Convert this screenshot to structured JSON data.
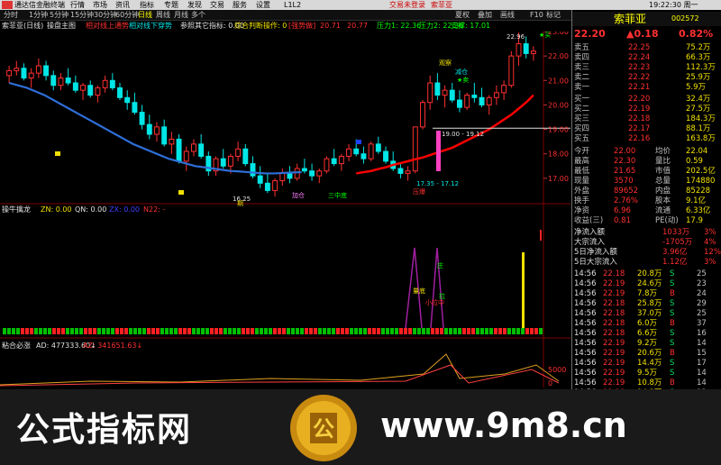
{
  "menu": {
    "app": "通达信金融终端",
    "items": [
      "行情",
      "市场",
      "资讯",
      "指标",
      "专题",
      "发现",
      "交易",
      "服务",
      "设置",
      "L1L2"
    ],
    "login": "交易未登录",
    "stock": "索菲亚",
    "quick": [
      "夏权",
      "叠加",
      "画线",
      "F10",
      "标记",
      "-",
      "□",
      "×"
    ]
  },
  "periods": [
    "分时",
    "1分钟",
    "5分钟",
    "15分钟",
    "30分钟",
    "60分钟",
    "日线",
    "周线",
    "月线",
    "多个"
  ],
  "title": {
    "name": "索菲亚(日线)",
    "indicator": "操盘主图",
    "t1": "相对线上通势",
    "t2": "相对线下穿势",
    "t3": "参照其它指标: 0.00",
    "t4": "综合判断操作: 0",
    "t5": "[强势做]",
    "t6": "20.71",
    "t7": "20.77",
    "t8": "压力1: 22.36",
    "t9": "压力2: 22.36",
    "t10": "支撑: 17.01"
  },
  "chart_data": [
    {
      "type": "candlestick",
      "title": "操盘主图",
      "ylim": [
        16,
        23
      ],
      "y_ticks": [
        23,
        22,
        21,
        20,
        19,
        18,
        17
      ],
      "annotations": [
        {
          "text": "22.96"
        },
        {
          "text": "★买"
        },
        {
          "text": "观察"
        },
        {
          "text": "减仓"
        },
        {
          "text": "★卖"
        },
        {
          "text": "19.00 - 19.12"
        },
        {
          "text": "16.25"
        },
        {
          "text": "17.35 - 17.12"
        },
        {
          "text": "加仓"
        },
        {
          "text": "三中底"
        },
        {
          "text": "压爆"
        },
        {
          "text": "期"
        }
      ],
      "series": [
        {
          "name": "K线",
          "ohlc": [
            [
              21.2,
              21.6,
              20.9,
              21.4
            ],
            [
              21.4,
              21.8,
              21.2,
              21.5
            ],
            [
              21.5,
              21.7,
              21.0,
              21.1
            ],
            [
              21.1,
              21.5,
              20.7,
              21.3
            ],
            [
              21.3,
              21.9,
              21.1,
              21.6
            ],
            [
              21.6,
              21.8,
              21.0,
              21.2
            ],
            [
              21.2,
              21.4,
              20.6,
              20.8
            ],
            [
              20.8,
              21.3,
              20.6,
              21.1
            ],
            [
              21.1,
              21.5,
              20.8,
              20.9
            ],
            [
              20.9,
              21.2,
              20.5,
              20.6
            ],
            [
              20.6,
              20.9,
              20.2,
              20.8
            ],
            [
              20.8,
              21.0,
              20.3,
              20.4
            ],
            [
              20.4,
              20.8,
              20.1,
              20.7
            ],
            [
              20.7,
              21.2,
              20.5,
              21.0
            ],
            [
              21.0,
              21.3,
              20.6,
              20.7
            ],
            [
              20.7,
              20.9,
              20.2,
              20.3
            ],
            [
              20.3,
              20.6,
              19.8,
              20.1
            ],
            [
              20.1,
              20.5,
              19.6,
              19.7
            ],
            [
              19.7,
              20.0,
              19.0,
              19.2
            ],
            [
              19.2,
              19.6,
              18.6,
              18.8
            ],
            [
              18.8,
              19.3,
              18.5,
              19.1
            ],
            [
              19.1,
              19.4,
              18.3,
              18.4
            ],
            [
              18.4,
              18.9,
              18.0,
              18.6
            ],
            [
              18.6,
              18.8,
              17.6,
              17.7
            ],
            [
              17.7,
              18.3,
              17.3,
              18.1
            ],
            [
              18.1,
              18.6,
              17.9,
              18.4
            ],
            [
              18.4,
              18.8,
              17.8,
              17.9
            ],
            [
              17.9,
              18.1,
              17.1,
              17.3
            ],
            [
              17.3,
              17.9,
              17.1,
              17.8
            ],
            [
              17.8,
              18.2,
              17.4,
              17.5
            ],
            [
              17.5,
              18.0,
              17.2,
              17.9
            ],
            [
              17.9,
              18.5,
              17.7,
              18.2
            ],
            [
              18.2,
              18.4,
              17.5,
              17.6
            ],
            [
              17.6,
              17.9,
              17.0,
              17.1
            ],
            [
              17.1,
              17.5,
              16.6,
              16.8
            ],
            [
              16.8,
              17.2,
              16.4,
              16.5
            ],
            [
              16.5,
              17.0,
              16.25,
              16.9
            ],
            [
              16.9,
              17.4,
              16.7,
              17.2
            ],
            [
              17.2,
              17.5,
              16.8,
              17.0
            ],
            [
              17.0,
              17.6,
              16.9,
              17.4
            ],
            [
              17.4,
              17.8,
              17.2,
              17.3
            ],
            [
              17.3,
              17.6,
              16.9,
              17.1
            ],
            [
              17.1,
              17.4,
              16.8,
              17.3
            ],
            [
              17.3,
              17.9,
              17.2,
              17.8
            ],
            [
              17.8,
              18.2,
              17.5,
              17.6
            ],
            [
              17.6,
              18.0,
              17.3,
              17.9
            ],
            [
              17.9,
              18.4,
              17.7,
              18.2
            ],
            [
              18.2,
              18.6,
              17.9,
              18.0
            ],
            [
              18.0,
              18.3,
              17.6,
              17.8
            ],
            [
              17.8,
              18.5,
              17.7,
              18.4
            ],
            [
              18.4,
              18.7,
              18.0,
              18.1
            ],
            [
              18.1,
              18.3,
              17.6,
              17.7
            ],
            [
              17.7,
              18.1,
              17.3,
              17.4
            ],
            [
              17.4,
              17.6,
              17.0,
              17.2
            ],
            [
              17.2,
              17.5,
              16.9,
              17.3
            ],
            [
              17.3,
              18.2,
              17.2,
              19.1
            ],
            [
              19.1,
              20.2,
              19.0,
              20.1
            ],
            [
              20.1,
              21.2,
              19.8,
              20.9
            ],
            [
              20.9,
              21.3,
              20.2,
              20.4
            ],
            [
              20.4,
              20.8,
              19.9,
              20.6
            ],
            [
              20.6,
              20.9,
              20.1,
              20.2
            ],
            [
              20.2,
              20.6,
              19.7,
              19.9
            ],
            [
              19.9,
              20.5,
              19.8,
              20.4
            ],
            [
              20.4,
              20.9,
              20.1,
              20.3
            ],
            [
              20.3,
              20.7,
              19.9,
              20.0
            ],
            [
              20.0,
              20.4,
              19.6,
              20.3
            ],
            [
              20.3,
              20.8,
              20.0,
              20.5
            ],
            [
              20.5,
              21.0,
              20.2,
              20.8
            ],
            [
              20.8,
              22.2,
              20.7,
              22.0
            ],
            [
              22.0,
              22.96,
              21.6,
              22.5
            ],
            [
              22.5,
              22.8,
              21.9,
              22.1
            ],
            [
              22.1,
              22.4,
              21.8,
              22.2
            ]
          ]
        },
        {
          "name": "蓝线",
          "values": [
            20.9,
            20.8,
            20.7,
            20.55,
            20.4,
            20.2,
            20.0,
            19.8,
            19.6,
            19.4,
            19.2,
            19.0,
            18.8,
            18.6,
            18.4,
            18.25,
            18.1,
            17.95,
            17.8,
            17.7,
            17.6,
            17.5,
            17.45,
            17.4,
            17.35,
            17.3,
            17.28,
            17.25,
            17.22,
            17.2,
            17.2,
            17.22,
            17.24,
            17.25
          ]
        },
        {
          "name": "红线",
          "values": [
            17.2,
            17.25,
            17.3,
            17.38,
            17.45,
            17.55,
            17.62,
            17.7,
            17.78,
            17.85,
            17.95,
            18.05,
            18.15,
            18.25,
            18.4,
            18.55,
            18.7,
            18.85,
            19.0,
            19.2,
            19.4,
            19.6,
            19.85,
            20.1,
            20.4
          ]
        }
      ]
    },
    {
      "type": "bar",
      "title": "操牛擒龙",
      "legend": [
        "ZN: 0.00",
        "QN: 0.00",
        "ZX: 0.00",
        "N22: -"
      ],
      "labels": [
        "量底",
        "庄",
        "小拉中",
        "拉"
      ]
    },
    {
      "type": "line",
      "title": "粘合必涨",
      "legend": [
        "AD: 477333.60↓",
        "AZ: 341651.63↓"
      ],
      "y_ticks": [
        5000,
        0
      ]
    }
  ],
  "quote": {
    "name": "索菲亚",
    "code": "002572",
    "change": "▲0.18",
    "pct": "0.82%",
    "price": "22.20",
    "asks": [
      [
        "卖五",
        "22.25",
        "75.2万"
      ],
      [
        "卖四",
        "22.24",
        "66.3万"
      ],
      [
        "卖三",
        "22.23",
        "112.3万"
      ],
      [
        "卖二",
        "22.22",
        "25.9万"
      ],
      [
        "卖一",
        "22.21",
        "5.9万"
      ]
    ],
    "bids": [
      [
        "买一",
        "22.20",
        "32.4万"
      ],
      [
        "买二",
        "22.19",
        "27.5万"
      ],
      [
        "买三",
        "22.18",
        "184.3万"
      ],
      [
        "买四",
        "22.17",
        "88.1万"
      ],
      [
        "买五",
        "22.16",
        "163.8万"
      ]
    ],
    "stats": [
      [
        "今开",
        "22.00",
        "均价",
        "22.04"
      ],
      [
        "最高",
        "22.30",
        "量比",
        "0.59"
      ],
      [
        "最低",
        "21.65",
        "市值",
        "202.5亿"
      ],
      [
        "现量",
        "3570",
        "总量",
        "174880"
      ],
      [
        "外盘",
        "89652",
        "内盘",
        "85228"
      ],
      [
        "换手",
        "2.76%",
        "股本",
        "9.1亿"
      ],
      [
        "净资",
        "6.96",
        "流通",
        "6.33亿"
      ],
      [
        "收益(三)",
        "0.81",
        "PE(动)",
        "17.9"
      ]
    ],
    "flows": [
      [
        "净流入额",
        "1033万",
        "3%"
      ],
      [
        "大宗流入",
        "-1705万",
        "4%"
      ],
      [
        "5日净流入额",
        "3.96亿",
        "12%"
      ],
      [
        "5日大宗流入",
        "1.12亿",
        "3%"
      ]
    ],
    "ticks": [
      [
        "14:56",
        "22.18",
        "20.8万",
        "S",
        "25"
      ],
      [
        "14:56",
        "22.19",
        "24.6万",
        "S",
        "23"
      ],
      [
        "14:56",
        "22.19",
        "7.8万",
        "B",
        "24"
      ],
      [
        "14:56",
        "22.18",
        "25.8万",
        "S",
        "29"
      ],
      [
        "14:56",
        "22.18",
        "37.0万",
        "S",
        "25"
      ],
      [
        "14:56",
        "22.18",
        "6.0万",
        "B",
        "37"
      ],
      [
        "14:56",
        "22.18",
        "6.6万",
        "S",
        "16"
      ],
      [
        "14:56",
        "22.19",
        "9.2万",
        "S",
        "14"
      ],
      [
        "14:56",
        "22.19",
        "20.6万",
        "B",
        "15"
      ],
      [
        "14:56",
        "22.19",
        "14.4万",
        "S",
        "17"
      ],
      [
        "14:56",
        "22.19",
        "9.5万",
        "S",
        "14"
      ],
      [
        "14:56",
        "22.19",
        "10.8万",
        "B",
        "14"
      ],
      [
        "14:56",
        "22.18",
        "14.3万",
        "S",
        "13"
      ],
      [
        "14:56",
        "22.19",
        "8.2万",
        "B",
        "10"
      ]
    ]
  },
  "watermark": {
    "brand": "公式指标网",
    "site": "www.9m8.cn",
    "logo": "公"
  },
  "colors": {
    "up": "#ff3030",
    "down": "#00e6e6",
    "ma_blue": "#2e6fd8",
    "ma_red": "#ff0000",
    "yellow": "#f0e000",
    "accent": "#ffff00"
  }
}
